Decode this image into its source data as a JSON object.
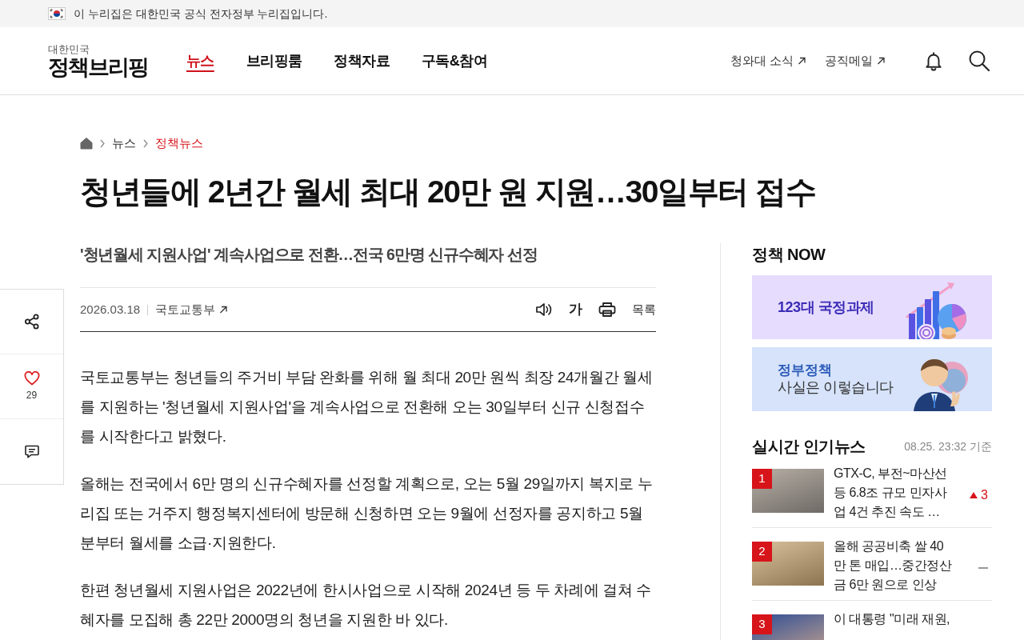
{
  "gov_banner": {
    "text": "이 누리집은 대한민국 공식 전자정부 누리집입니다."
  },
  "header": {
    "logo": {
      "subtitle": "대한민국",
      "wordmark": "정책브리핑"
    },
    "nav": [
      {
        "label": "뉴스",
        "selected": true
      },
      {
        "label": "브리핑룸",
        "selected": false
      },
      {
        "label": "정책자료",
        "selected": false
      },
      {
        "label": "구독&참여",
        "selected": false
      }
    ],
    "links": [
      {
        "label": "청와대 소식"
      },
      {
        "label": "공직메일"
      }
    ]
  },
  "breadcrumb": [
    {
      "label": "뉴스",
      "current": false
    },
    {
      "label": "정책뉴스",
      "current": true
    }
  ],
  "article": {
    "title": "청년들에 2년간 월세 최대 20만 원 지원…30일부터 접수",
    "subtitle": "'청년월세 지원사업' 계속사업으로 전환…전국 6만명 신규수혜자 선정",
    "date": "2026.03.18",
    "source": "국토교통부",
    "font_size_label": "가",
    "list_label": "목록",
    "paragraphs": [
      "국토교통부는 청년들의 주거비 부담 완화를 위해 월 최대 20만 원씩 최장 24개월간 월세를 지원하는 '청년월세 지원사업'을 계속사업으로 전환해 오는 30일부터 신규 신청접수를 시작한다고 밝혔다.",
      "올해는 전국에서 6만 명의 신규수혜자를 선정할 계획으로, 오는 5월 29일까지 복지로 누리집 또는 거주지 행정복지센터에 방문해 신청하면 오는 9월에 선정자를 공지하고 5월분부터 월세를 소급·지원한다.",
      "한편 청년월세 지원사업은 2022년에 한시사업으로 시작해 2024년 등 두 차례에 걸쳐 수혜자를 모집해 총 22만 2000명의 청년을 지원한 바 있다."
    ]
  },
  "side_actions": {
    "likes": "29"
  },
  "sidebar": {
    "policy_now": {
      "title": "정책 NOW",
      "banners": [
        {
          "kind": "agenda",
          "text": "123대 국정과제"
        },
        {
          "kind": "facts",
          "heading": "정부정책",
          "text": "사실은 이렇습니다"
        }
      ]
    },
    "popular": {
      "title": "실시간 인기뉴스",
      "timestamp": "08.25. 23:32 기준",
      "items": [
        {
          "rank": "1",
          "title": "GTX-C, 부전~마산선 등 6.8조 규모 민자사업 4건 추진 속도 …",
          "change": {
            "kind": "up",
            "value": "3"
          }
        },
        {
          "rank": "2",
          "title": "올해 공공비축 쌀 40만 톤 매입…중간정산금 6만 원으로 인상",
          "change": {
            "kind": "same"
          }
        },
        {
          "rank": "3",
          "title": "이 대통령 \"미래 재원,"
        }
      ]
    }
  }
}
